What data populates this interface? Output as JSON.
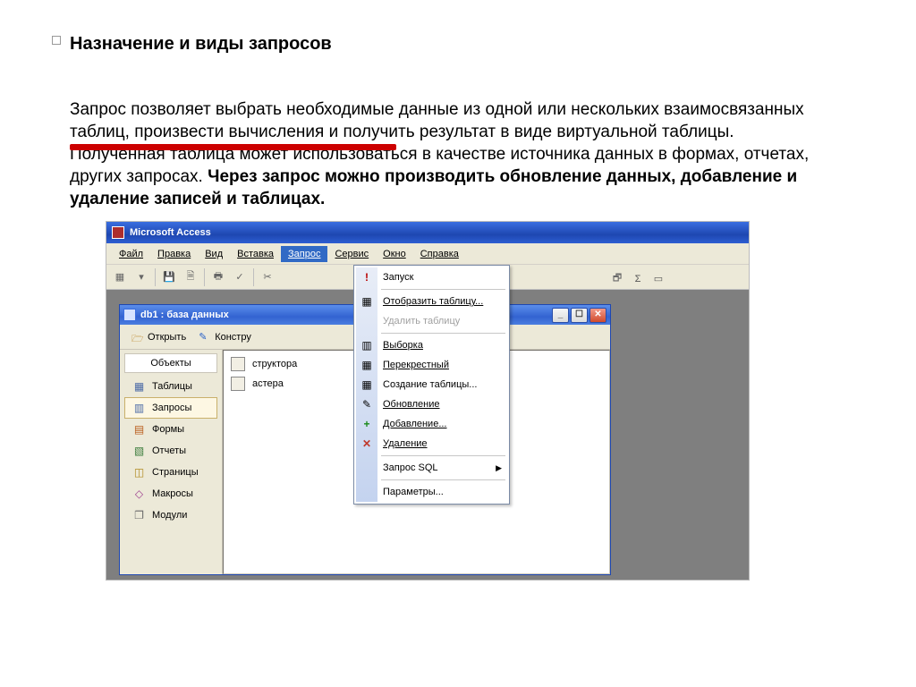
{
  "heading": "Назначение и виды запросов",
  "body": {
    "p1a": "Запрос позволяет выбрать необходимые данные из одной или нескольких взаимосвязанных таблиц",
    "p1b": ", произвести вычисления и получить результат в виде виртуальной таблицы.",
    "p2": "Полученная таблица может использоваться в качестве источника данных в формах, отчетах, других запросах. ",
    "p2_bold": "Через запрос можно производить обновление данных, добавление и удаление записей и таблицах."
  },
  "app": {
    "title": "Microsoft Access"
  },
  "menubar": [
    "Файл",
    "Правка",
    "Вид",
    "Вставка",
    "Запрос",
    "Сервис",
    "Окно",
    "Справка"
  ],
  "dbwin": {
    "title": "db1 : база данных",
    "toolbar": {
      "open": "Открыть",
      "design": "Констру"
    }
  },
  "sidebar": {
    "header": "Объекты",
    "items": [
      {
        "label": "Таблицы",
        "icon": "▦"
      },
      {
        "label": "Запросы",
        "icon": "▥",
        "selected": true
      },
      {
        "label": "Формы",
        "icon": "▤"
      },
      {
        "label": "Отчеты",
        "icon": "▧"
      },
      {
        "label": "Страницы",
        "icon": "◫"
      },
      {
        "label": "Макросы",
        "icon": "◇"
      },
      {
        "label": "Модули",
        "icon": "❐"
      }
    ]
  },
  "objlist": {
    "items": [
      {
        "label": "структора"
      },
      {
        "label": "астера"
      }
    ]
  },
  "dropdown": {
    "items": [
      {
        "label": "Запуск",
        "icon": "!",
        "icon_color": "#b80000"
      },
      {
        "sep": true
      },
      {
        "label": "Отобразить таблицу...",
        "icon": "▦",
        "icon_color": "#6b6b6b"
      },
      {
        "label": "Удалить таблицу",
        "disabled": true
      },
      {
        "sep": true
      },
      {
        "label": "Выборка",
        "icon": "▥",
        "icon_color": "#6b6b6b"
      },
      {
        "label": "Перекрестный",
        "icon": "▦",
        "icon_color": "#6b6b6b"
      },
      {
        "label": "Создание таблицы...",
        "icon": "▦",
        "icon_color": "#6b6b6b"
      },
      {
        "label": "Обновление",
        "icon": "✎",
        "icon_color": "#6b6b6b"
      },
      {
        "label": "Добавление...",
        "icon": "+",
        "icon_color": "#1a8a1a"
      },
      {
        "label": "Удаление",
        "icon": "✕",
        "icon_color": "#c0392b"
      },
      {
        "sep": true
      },
      {
        "label": "Запрос SQL",
        "submenu": true
      },
      {
        "sep": true
      },
      {
        "label": "Параметры..."
      }
    ]
  }
}
